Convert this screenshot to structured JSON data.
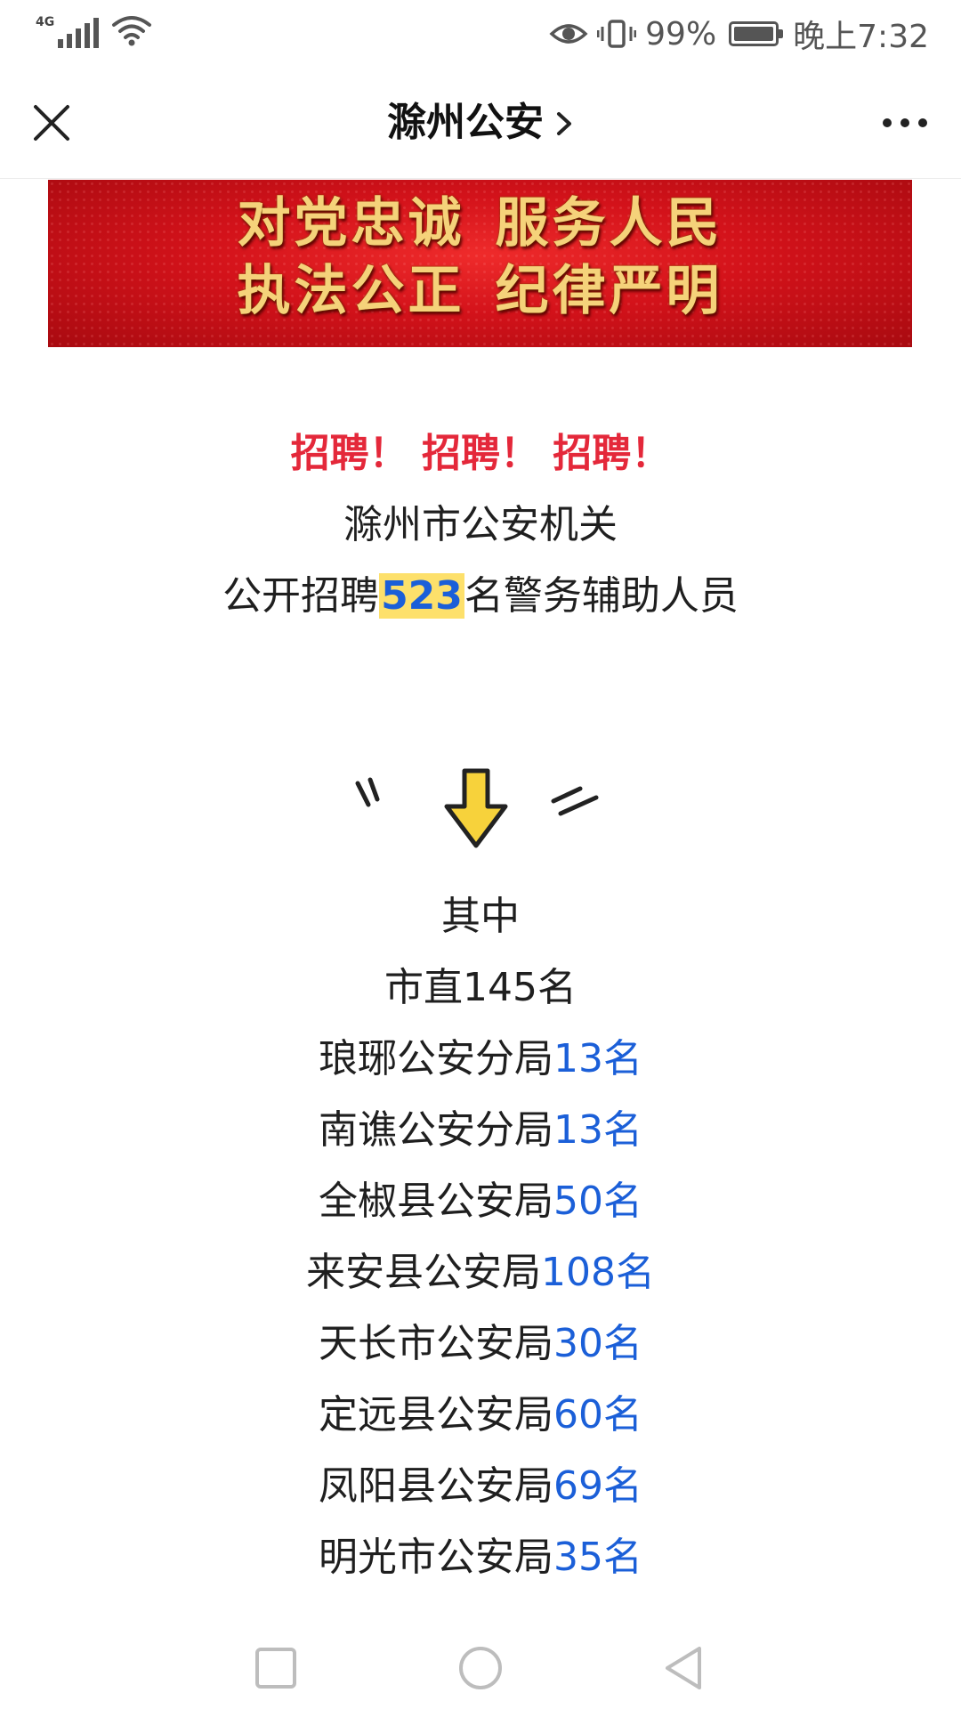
{
  "status_bar": {
    "network": "4G",
    "battery": "99%",
    "battery_level": 0.99,
    "time": "晚上7:32"
  },
  "title_bar": {
    "title": "滁州公安"
  },
  "banner": {
    "line1_a": "对党忠诚",
    "line1_b": "服务人民",
    "line2_a": "执法公正",
    "line2_b": "纪律严明"
  },
  "article": {
    "headline": "招聘！ 招聘！ 招聘！",
    "subtitle": "滁州市公安机关",
    "recruit_prefix": "公开招聘",
    "recruit_count": "523",
    "recruit_suffix": "名警务辅助人员",
    "among": "其中",
    "city_direct": "市直145名",
    "branches": [
      {
        "name": "琅琊公安分局",
        "count": "13名"
      },
      {
        "name": "南谯公安分局",
        "count": "13名"
      },
      {
        "name": "全椒县公安局",
        "count": "50名"
      },
      {
        "name": "来安县公安局",
        "count": "108名"
      },
      {
        "name": "天长市公安局",
        "count": "30名"
      },
      {
        "name": "定远县公安局",
        "count": "60名"
      },
      {
        "name": "凤阳县公安局",
        "count": "69名"
      },
      {
        "name": "明光市公安局",
        "count": "35名"
      }
    ]
  },
  "colors": {
    "headline_red": "#e4283a",
    "count_blue": "#1b5fd8",
    "highlight_yellow": "#fde06b",
    "banner_red": "#d3121a",
    "banner_gold": "#f5d27a"
  }
}
